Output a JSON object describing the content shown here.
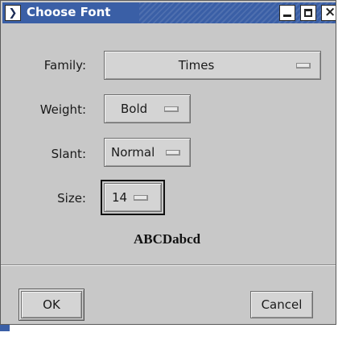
{
  "window": {
    "title": "Choose Font",
    "title_bar_color": "#3a5fa6",
    "icons": [
      "window-menu-icon",
      "minimize-icon",
      "maximize-icon",
      "close-icon"
    ]
  },
  "form": {
    "family": {
      "label": "Family:",
      "value": "Times"
    },
    "weight": {
      "label": "Weight:",
      "value": "Bold"
    },
    "slant": {
      "label": "Slant:",
      "value": "Normal"
    },
    "size": {
      "label": "Size:",
      "value": "14"
    }
  },
  "preview": {
    "text": "ABCDabcd"
  },
  "buttons": {
    "ok": "OK",
    "cancel": "Cancel"
  }
}
